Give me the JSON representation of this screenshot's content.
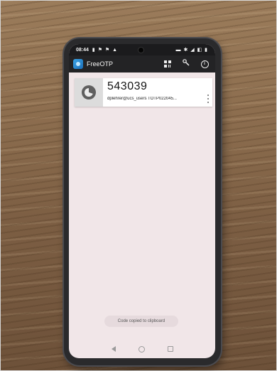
{
  "status_bar": {
    "time": "08:44",
    "notification_icons": "▮ ⚑ ⚑ ▲",
    "system_icons": "▬ ✱ ◢ ◧ ▮"
  },
  "app": {
    "title": "FreeOTP",
    "actions": [
      {
        "name": "scan-qr-code",
        "icon": "qr-code-icon"
      },
      {
        "name": "add-token",
        "icon": "key-plus-icon",
        "glyph": "🔑"
      },
      {
        "name": "about",
        "icon": "info-icon",
        "glyph": "i"
      }
    ]
  },
  "token": {
    "code": "543039",
    "label": "dplehrer@ucs_users TOTP022045...",
    "icon": "countdown-timer-icon"
  },
  "toast": {
    "text": "Code copied to clipboard"
  },
  "nav": {
    "back_icon": "back-triangle-icon",
    "home_icon": "home-circle-icon",
    "recents_icon": "recents-square-icon"
  }
}
